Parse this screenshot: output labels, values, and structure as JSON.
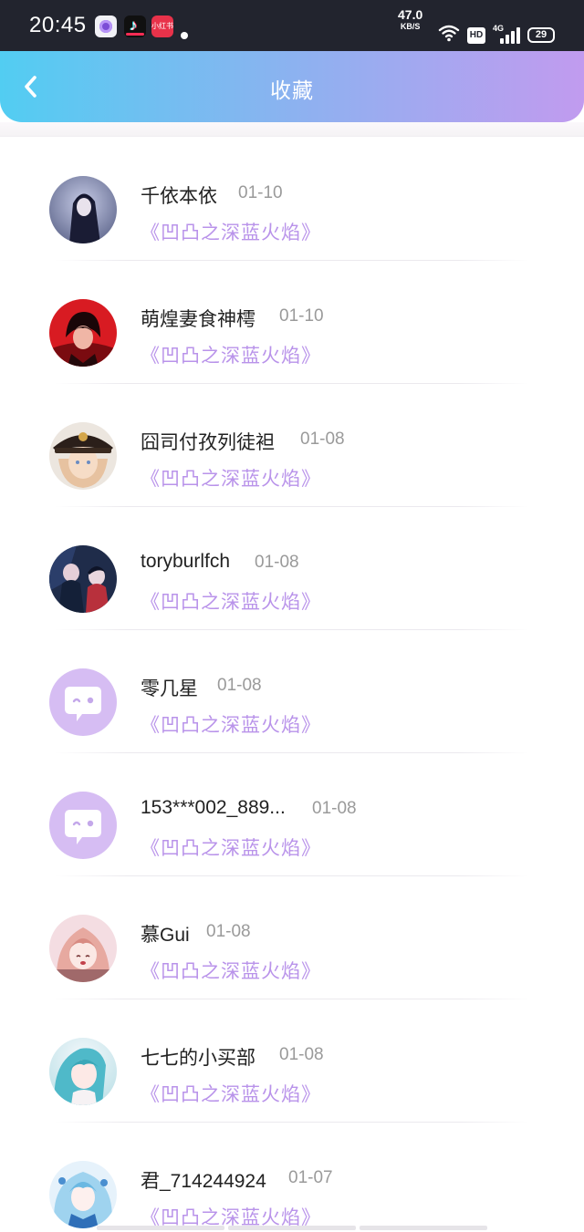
{
  "status_bar": {
    "time": "20:45",
    "net_speed_value": "47.0",
    "net_speed_unit": "KB/S",
    "hd": "HD",
    "network": "4G",
    "battery": "29",
    "notification_icons": [
      "app-icon",
      "tiktok-icon",
      "xiaohongshu-icon"
    ]
  },
  "header": {
    "title": "收藏",
    "back_icon": "chevron-left-icon",
    "gradient": [
      "#52cdf2",
      "#c19bef"
    ]
  },
  "colors": {
    "accent": "#b993ea",
    "name_text": "#222222",
    "date_text": "#9a9a9a"
  },
  "items": [
    {
      "name": "千依本依",
      "date": "01-10",
      "title": "《凹凸之深蓝火焰》",
      "avatar": "dark-girl-avatar"
    },
    {
      "name": "萌煌妻食神樗",
      "date": "01-10",
      "title": "《凹凸之深蓝火焰》",
      "avatar": "red-boy-avatar"
    },
    {
      "name": "囧司付孜列徒袒",
      "date": "01-08",
      "title": "《凹凸之深蓝火焰》",
      "avatar": "military-cap-avatar"
    },
    {
      "name": "toryburlfch",
      "date": "01-08",
      "title": "《凹凸之深蓝火焰》",
      "avatar": "dark-duo-avatar"
    },
    {
      "name": "零几星",
      "date": "01-08",
      "title": "《凹凸之深蓝火焰》",
      "avatar": "default-chat-avatar"
    },
    {
      "name": "153***002_889...",
      "date": "01-08",
      "title": "《凹凸之深蓝火焰》",
      "avatar": "default-chat-avatar"
    },
    {
      "name": "慕Gui",
      "date": "01-08",
      "title": "《凹凸之深蓝火焰》",
      "avatar": "pink-girl-avatar"
    },
    {
      "name": "七七的小买部",
      "date": "01-08",
      "title": "《凹凸之深蓝火焰》",
      "avatar": "teal-girl-avatar"
    },
    {
      "name": "君_714244924",
      "date": "01-07",
      "title": "《凹凸之深蓝火焰》",
      "avatar": "blue-girl-avatar"
    }
  ]
}
